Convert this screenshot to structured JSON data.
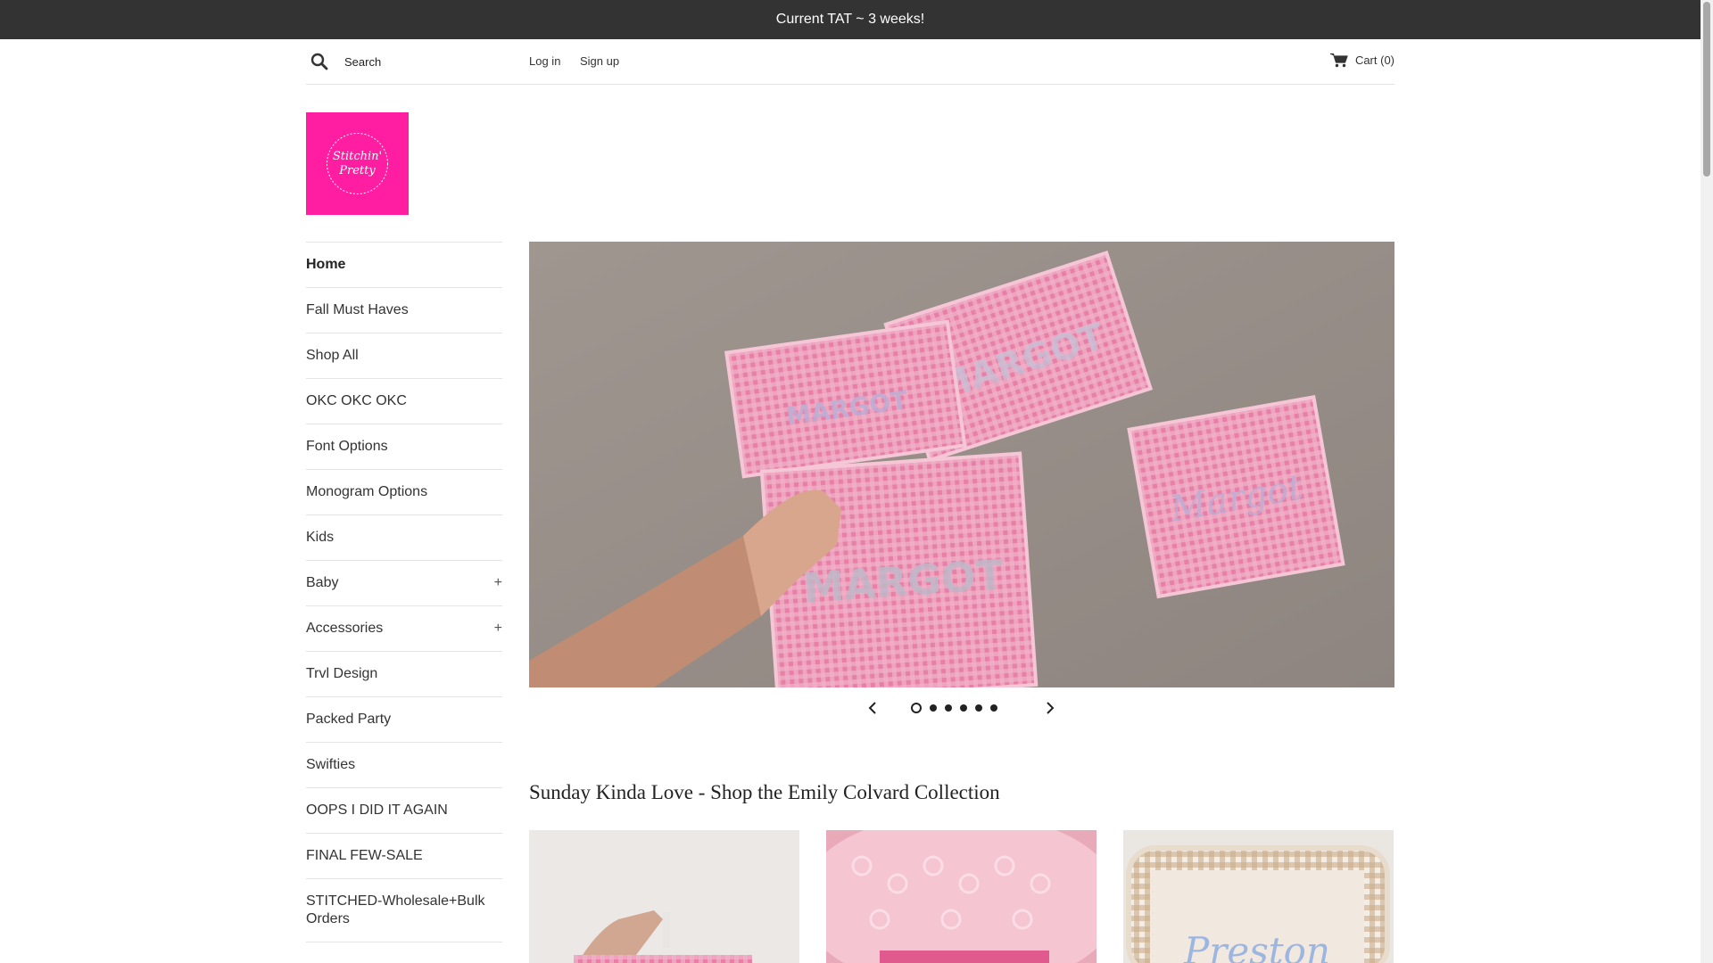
{
  "announcement": "Current TAT ~ 3 weeks!",
  "header": {
    "search_placeholder": "Search",
    "login": "Log in",
    "signup": "Sign up",
    "cart": "Cart (0)"
  },
  "logo": {
    "text": "Stitchin' Pretty",
    "color": "#ff1ea2"
  },
  "nav": [
    {
      "label": "Home",
      "active": true
    },
    {
      "label": "Fall Must Haves"
    },
    {
      "label": "Shop All"
    },
    {
      "label": "OKC OKC OKC"
    },
    {
      "label": "Font Options"
    },
    {
      "label": "Monogram Options"
    },
    {
      "label": "Kids"
    },
    {
      "label": "Baby",
      "expandable": "+"
    },
    {
      "label": "Accessories",
      "expandable": "+"
    },
    {
      "label": "Trvl Design"
    },
    {
      "label": "Packed Party"
    },
    {
      "label": "Swifties"
    },
    {
      "label": "OOPS I DID IT AGAIN"
    },
    {
      "label": "FINAL FEW-SALE"
    },
    {
      "label": "STITCHED-Wholesale+Bulk Orders"
    }
  ],
  "hero": {
    "slide_count": 6,
    "active_slide": 1,
    "embroidered_names": [
      "MARGOT",
      "MARGOT",
      "Margot",
      "MARGOT"
    ]
  },
  "section": {
    "title": "Sunday Kinda Love - Shop the Emily Colvard Collection"
  },
  "products": [
    {
      "icon": "pink-gingham-pouch-image"
    },
    {
      "icon": "pink-pattern-pouch-image"
    },
    {
      "icon": "tan-gingham-pouch-image",
      "embroidered_name": "Preston"
    }
  ]
}
